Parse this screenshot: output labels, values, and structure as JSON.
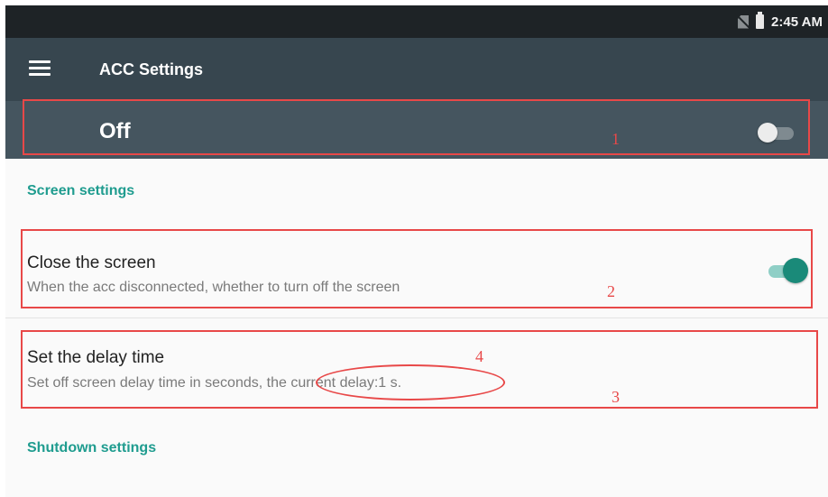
{
  "status_bar": {
    "time": "2:45 AM",
    "icons": [
      "no-sim-icon",
      "battery-icon"
    ]
  },
  "app_bar": {
    "title": "ACC Settings",
    "menu_icon": "hamburger-menu-icon"
  },
  "master_switch": {
    "label": "Off",
    "checked": false
  },
  "sections": {
    "screen": {
      "header": "Screen settings",
      "close_screen": {
        "title": "Close the screen",
        "summary": "When the acc disconnected, whether to turn off the screen",
        "checked": true
      },
      "delay_time": {
        "title": "Set the delay time",
        "summary_prefix": "Set off screen delay time in seconds,",
        "summary_current": "the current delay:1 s."
      }
    },
    "shutdown": {
      "header": "Shutdown settings"
    }
  },
  "annotations": {
    "n1": "1",
    "n2": "2",
    "n3": "3",
    "n4": "4"
  },
  "colors": {
    "status_bar": "#1e2326",
    "app_bar": "#37464f",
    "master_bar": "#45555f",
    "accent": "#1f9c8f",
    "switch_on": "#1a8a79",
    "annotation": "#e84848"
  }
}
